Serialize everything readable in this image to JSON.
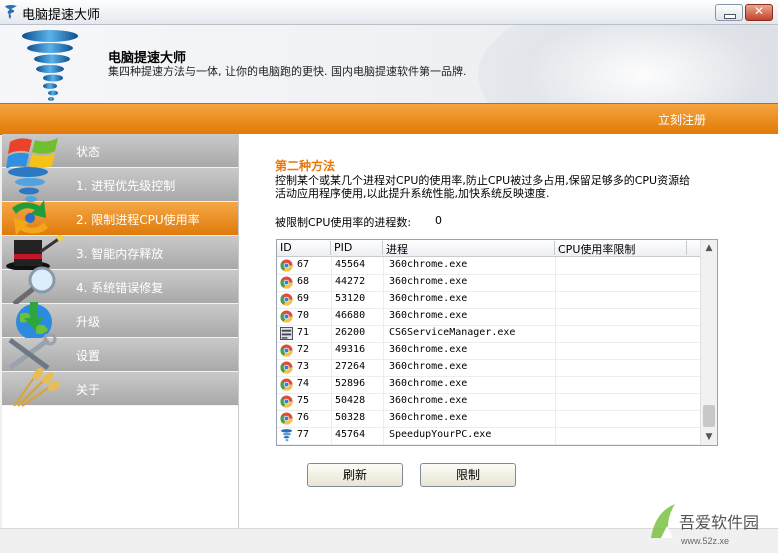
{
  "window": {
    "title": "电脑提速大师"
  },
  "header": {
    "app_name": "电脑提速大师",
    "slogan": "集四种提速方法与一体, 让你的电脑跑的更快. 国内电脑提速软件第一品牌."
  },
  "toolbar": {
    "register_label": "立刻注册"
  },
  "sidebar": {
    "items": [
      {
        "label": "状态",
        "icon": "windows-logo-icon",
        "active": false
      },
      {
        "label": "1. 进程优先级控制",
        "icon": "tornado-icon",
        "active": false
      },
      {
        "label": "2. 限制进程CPU使用率",
        "icon": "refresh-arrows-icon",
        "active": true
      },
      {
        "label": "3. 智能内存释放",
        "icon": "magic-hat-icon",
        "active": false
      },
      {
        "label": "4. 系统错误修复",
        "icon": "magnifier-icon",
        "active": false
      },
      {
        "label": "升级",
        "icon": "globe-download-icon",
        "active": false
      },
      {
        "label": "设置",
        "icon": "tools-icon",
        "active": false
      },
      {
        "label": "关于",
        "icon": "wheat-icon",
        "active": false
      }
    ]
  },
  "main": {
    "section_title": "第二种方法",
    "description": "控制某个或某几个进程对CPU的使用率,防止CPU被过多占用,保留足够多的CPU资源给活动应用程序使用,以此提升系统性能,加快系统反映速度.",
    "count_label": "被限制CPU使用率的进程数:",
    "count_value": "0",
    "table": {
      "columns": [
        "ID",
        "PID",
        "进程",
        "CPU使用率限制"
      ],
      "rows": [
        {
          "id": "67",
          "pid": "45564",
          "name": "360chrome.exe",
          "limit": "",
          "icon": "chrome-icon"
        },
        {
          "id": "68",
          "pid": "44272",
          "name": "360chrome.exe",
          "limit": "",
          "icon": "chrome-icon"
        },
        {
          "id": "69",
          "pid": "53120",
          "name": "360chrome.exe",
          "limit": "",
          "icon": "chrome-icon"
        },
        {
          "id": "70",
          "pid": "46680",
          "name": "360chrome.exe",
          "limit": "",
          "icon": "chrome-icon"
        },
        {
          "id": "71",
          "pid": "26200",
          "name": "CS6ServiceManager.exe",
          "limit": "",
          "icon": "service-icon"
        },
        {
          "id": "72",
          "pid": "49316",
          "name": "360chrome.exe",
          "limit": "",
          "icon": "chrome-icon"
        },
        {
          "id": "73",
          "pid": "27264",
          "name": "360chrome.exe",
          "limit": "",
          "icon": "chrome-icon"
        },
        {
          "id": "74",
          "pid": "52896",
          "name": "360chrome.exe",
          "limit": "",
          "icon": "chrome-icon"
        },
        {
          "id": "75",
          "pid": "50428",
          "name": "360chrome.exe",
          "limit": "",
          "icon": "chrome-icon"
        },
        {
          "id": "76",
          "pid": "50328",
          "name": "360chrome.exe",
          "limit": "",
          "icon": "chrome-icon"
        },
        {
          "id": "77",
          "pid": "45764",
          "name": "SpeedupYourPC.exe",
          "limit": "",
          "icon": "tornado-icon"
        }
      ]
    },
    "buttons": {
      "refresh": "刷新",
      "limit": "限制"
    }
  },
  "watermark": {
    "text": "吾爱软件园",
    "url_text": "www.52z.xe"
  },
  "colors": {
    "accent": "#e8780a",
    "bar_gray": "#b5b5b5"
  }
}
